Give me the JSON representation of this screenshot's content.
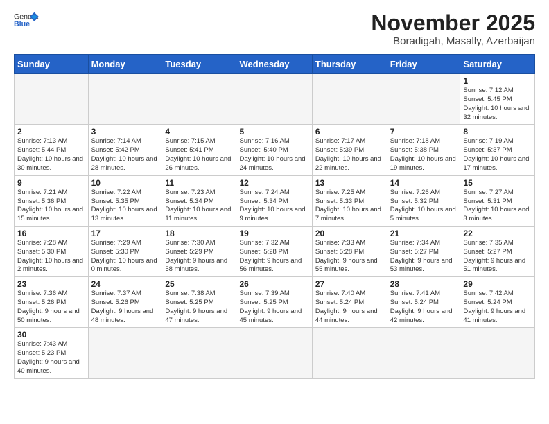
{
  "header": {
    "logo_general": "General",
    "logo_blue": "Blue",
    "month_title": "November 2025",
    "location": "Boradigah, Masally, Azerbaijan"
  },
  "weekdays": [
    "Sunday",
    "Monday",
    "Tuesday",
    "Wednesday",
    "Thursday",
    "Friday",
    "Saturday"
  ],
  "days": {
    "1": {
      "num": "1",
      "sunrise": "7:12 AM",
      "sunset": "5:45 PM",
      "daylight": "10 hours and 32 minutes."
    },
    "2": {
      "num": "2",
      "sunrise": "7:13 AM",
      "sunset": "5:44 PM",
      "daylight": "10 hours and 30 minutes."
    },
    "3": {
      "num": "3",
      "sunrise": "7:14 AM",
      "sunset": "5:42 PM",
      "daylight": "10 hours and 28 minutes."
    },
    "4": {
      "num": "4",
      "sunrise": "7:15 AM",
      "sunset": "5:41 PM",
      "daylight": "10 hours and 26 minutes."
    },
    "5": {
      "num": "5",
      "sunrise": "7:16 AM",
      "sunset": "5:40 PM",
      "daylight": "10 hours and 24 minutes."
    },
    "6": {
      "num": "6",
      "sunrise": "7:17 AM",
      "sunset": "5:39 PM",
      "daylight": "10 hours and 22 minutes."
    },
    "7": {
      "num": "7",
      "sunrise": "7:18 AM",
      "sunset": "5:38 PM",
      "daylight": "10 hours and 19 minutes."
    },
    "8": {
      "num": "8",
      "sunrise": "7:19 AM",
      "sunset": "5:37 PM",
      "daylight": "10 hours and 17 minutes."
    },
    "9": {
      "num": "9",
      "sunrise": "7:21 AM",
      "sunset": "5:36 PM",
      "daylight": "10 hours and 15 minutes."
    },
    "10": {
      "num": "10",
      "sunrise": "7:22 AM",
      "sunset": "5:35 PM",
      "daylight": "10 hours and 13 minutes."
    },
    "11": {
      "num": "11",
      "sunrise": "7:23 AM",
      "sunset": "5:34 PM",
      "daylight": "10 hours and 11 minutes."
    },
    "12": {
      "num": "12",
      "sunrise": "7:24 AM",
      "sunset": "5:34 PM",
      "daylight": "10 hours and 9 minutes."
    },
    "13": {
      "num": "13",
      "sunrise": "7:25 AM",
      "sunset": "5:33 PM",
      "daylight": "10 hours and 7 minutes."
    },
    "14": {
      "num": "14",
      "sunrise": "7:26 AM",
      "sunset": "5:32 PM",
      "daylight": "10 hours and 5 minutes."
    },
    "15": {
      "num": "15",
      "sunrise": "7:27 AM",
      "sunset": "5:31 PM",
      "daylight": "10 hours and 3 minutes."
    },
    "16": {
      "num": "16",
      "sunrise": "7:28 AM",
      "sunset": "5:30 PM",
      "daylight": "10 hours and 2 minutes."
    },
    "17": {
      "num": "17",
      "sunrise": "7:29 AM",
      "sunset": "5:30 PM",
      "daylight": "10 hours and 0 minutes."
    },
    "18": {
      "num": "18",
      "sunrise": "7:30 AM",
      "sunset": "5:29 PM",
      "daylight": "9 hours and 58 minutes."
    },
    "19": {
      "num": "19",
      "sunrise": "7:32 AM",
      "sunset": "5:28 PM",
      "daylight": "9 hours and 56 minutes."
    },
    "20": {
      "num": "20",
      "sunrise": "7:33 AM",
      "sunset": "5:28 PM",
      "daylight": "9 hours and 55 minutes."
    },
    "21": {
      "num": "21",
      "sunrise": "7:34 AM",
      "sunset": "5:27 PM",
      "daylight": "9 hours and 53 minutes."
    },
    "22": {
      "num": "22",
      "sunrise": "7:35 AM",
      "sunset": "5:27 PM",
      "daylight": "9 hours and 51 minutes."
    },
    "23": {
      "num": "23",
      "sunrise": "7:36 AM",
      "sunset": "5:26 PM",
      "daylight": "9 hours and 50 minutes."
    },
    "24": {
      "num": "24",
      "sunrise": "7:37 AM",
      "sunset": "5:26 PM",
      "daylight": "9 hours and 48 minutes."
    },
    "25": {
      "num": "25",
      "sunrise": "7:38 AM",
      "sunset": "5:25 PM",
      "daylight": "9 hours and 47 minutes."
    },
    "26": {
      "num": "26",
      "sunrise": "7:39 AM",
      "sunset": "5:25 PM",
      "daylight": "9 hours and 45 minutes."
    },
    "27": {
      "num": "27",
      "sunrise": "7:40 AM",
      "sunset": "5:24 PM",
      "daylight": "9 hours and 44 minutes."
    },
    "28": {
      "num": "28",
      "sunrise": "7:41 AM",
      "sunset": "5:24 PM",
      "daylight": "9 hours and 42 minutes."
    },
    "29": {
      "num": "29",
      "sunrise": "7:42 AM",
      "sunset": "5:24 PM",
      "daylight": "9 hours and 41 minutes."
    },
    "30": {
      "num": "30",
      "sunrise": "7:43 AM",
      "sunset": "5:23 PM",
      "daylight": "9 hours and 40 minutes."
    }
  }
}
